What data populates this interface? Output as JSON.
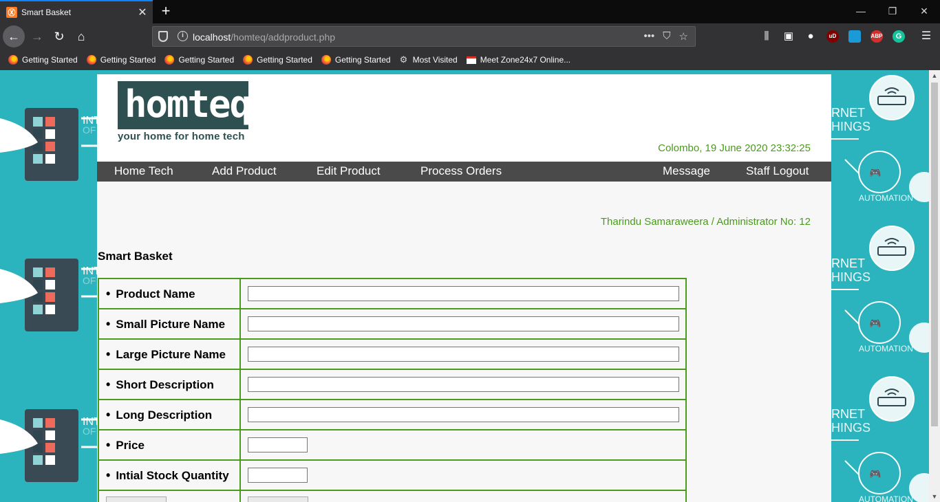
{
  "browser": {
    "tab_title": "Smart Basket",
    "tab_favicon_letter": "Ⓧ",
    "url_host": "localhost",
    "url_path": "/homteq/addproduct.php",
    "bookmarks": [
      {
        "label": "Getting Started",
        "icon": "firefox-icon"
      },
      {
        "label": "Getting Started",
        "icon": "firefox-icon"
      },
      {
        "label": "Getting Started",
        "icon": "firefox-icon"
      },
      {
        "label": "Getting Started",
        "icon": "firefox-icon"
      },
      {
        "label": "Getting Started",
        "icon": "firefox-icon"
      },
      {
        "label": "Most Visited",
        "icon": "gear-icon"
      },
      {
        "label": "Meet Zone24x7 Online...",
        "icon": "gmail-icon"
      }
    ],
    "extensions": [
      "uBlock",
      "ABP",
      "Grammarly"
    ],
    "extension_labels": {
      "ublock": "uD",
      "abp": "ABP",
      "grammarly": "G"
    }
  },
  "site": {
    "logo_text": "homteq`",
    "tagline": "your home for home tech",
    "dateline": "Colombo, 19 June 2020 23:32:25",
    "menu": {
      "home": "Home Tech",
      "add": "Add Product",
      "edit": "Edit Product",
      "process": "Process Orders",
      "message": "Message",
      "logout": "Staff Logout"
    },
    "user_line": "Tharindu Samaraweera / Administrator No: 12",
    "page_heading": "Smart Basket"
  },
  "form": {
    "rows": [
      {
        "label": "Product Name",
        "value": ""
      },
      {
        "label": "Small Picture Name",
        "value": ""
      },
      {
        "label": "Large Picture Name",
        "value": ""
      },
      {
        "label": "Short Description",
        "value": ""
      },
      {
        "label": "Long Description",
        "value": ""
      },
      {
        "label": "Price",
        "value": ""
      },
      {
        "label": "Intial Stock Quantity",
        "value": ""
      }
    ]
  },
  "colors": {
    "accent_green": "#4a9a1c",
    "logo_bg": "#2f5050",
    "menu_bg": "#4a4a4a",
    "background_teal": "#2bb4bd"
  }
}
